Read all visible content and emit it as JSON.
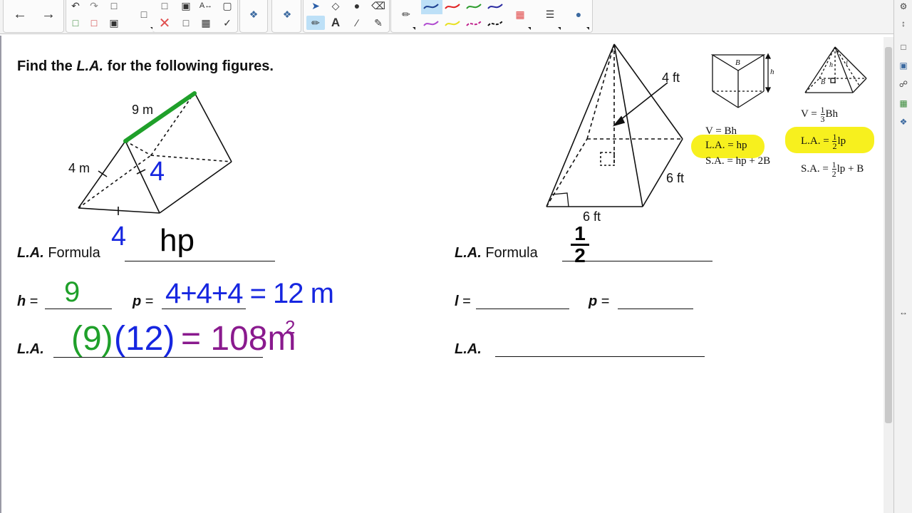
{
  "toolbar": {
    "icons": [
      "back-arrow-icon",
      "forward-arrow-icon",
      "undo-icon",
      "redo-icon",
      "new-page-icon",
      "delete-page-icon",
      "save-icon",
      "clear-icon",
      "screen-shade-icon",
      "capture-icon",
      "table-icon",
      "text-recognize-icon",
      "record-icon",
      "spell-icon",
      "addons-icon",
      "select-icon",
      "shapes-icon",
      "fill-icon",
      "eraser-icon",
      "text-icon",
      "line-icon",
      "pen-icon",
      "color-palette-icon",
      "line-properties-icon",
      "properties-icon"
    ],
    "pen_colors": {
      "dark-blue": "#1b3f8f",
      "red": "#e02020",
      "green": "#2c9c2c",
      "navy": "#2a2aa0",
      "purple": "#b04bd0",
      "yellow": "#e8e020",
      "magenta": "#c0208c",
      "black": "#111111"
    }
  },
  "worksheet": {
    "heading_prefix": "Find the ",
    "heading_la": "L.A.",
    "heading_suffix": " for the following figures.",
    "prism": {
      "label_9m": "9 m",
      "label_4m": "4 m"
    },
    "pyramid": {
      "label_4ft": "4 ft",
      "label_6ft_side": "6 ft",
      "label_6ft_base": "6 ft"
    },
    "left": {
      "la_formula_label_italic": "L.A.",
      "la_formula_label": " Formula",
      "h_label": "h",
      "p_label": "p",
      "eq": " =",
      "la_label": "L.A."
    },
    "right": {
      "la_formula_label_italic": "L.A.",
      "la_formula_label": " Formula",
      "l_label": "l",
      "p_label": "p",
      "eq": " =",
      "la_label": "L.A."
    },
    "ref_prism": {
      "B": "B",
      "h": "h",
      "V": "V = Bh",
      "LA": "L.A. = hp",
      "SA": "S.A. = hp + 2B"
    },
    "ref_pyramid": {
      "B": "B",
      "h": "h",
      "l": "l",
      "V_prefix": "V = ",
      "V_suffix": "Bh",
      "LA_prefix": "L.A. = ",
      "LA_suffix": "lp",
      "SA_prefix": "S.A. = ",
      "SA_suffix": "lp + B",
      "frac_1_3_num": "1",
      "frac_1_3_den": "3",
      "frac_1_2_num": "1",
      "frac_1_2_den": "2"
    }
  },
  "handwriting": {
    "side_4": "4",
    "base_4": "4",
    "hp": "hp",
    "h_value": "9",
    "p_value": "4+4+4 = 12 m",
    "la_green": "(9)",
    "la_blue": "(12)",
    "la_purple": "= 108m",
    "la_exp": "2",
    "half_num": "1",
    "half_den": "2"
  },
  "colors": {
    "ink_green": "#1fa02a",
    "ink_blue": "#1626e0",
    "ink_purple": "#8a1a8e",
    "ink_black": "#000000",
    "highlight": "#f7f01e"
  }
}
